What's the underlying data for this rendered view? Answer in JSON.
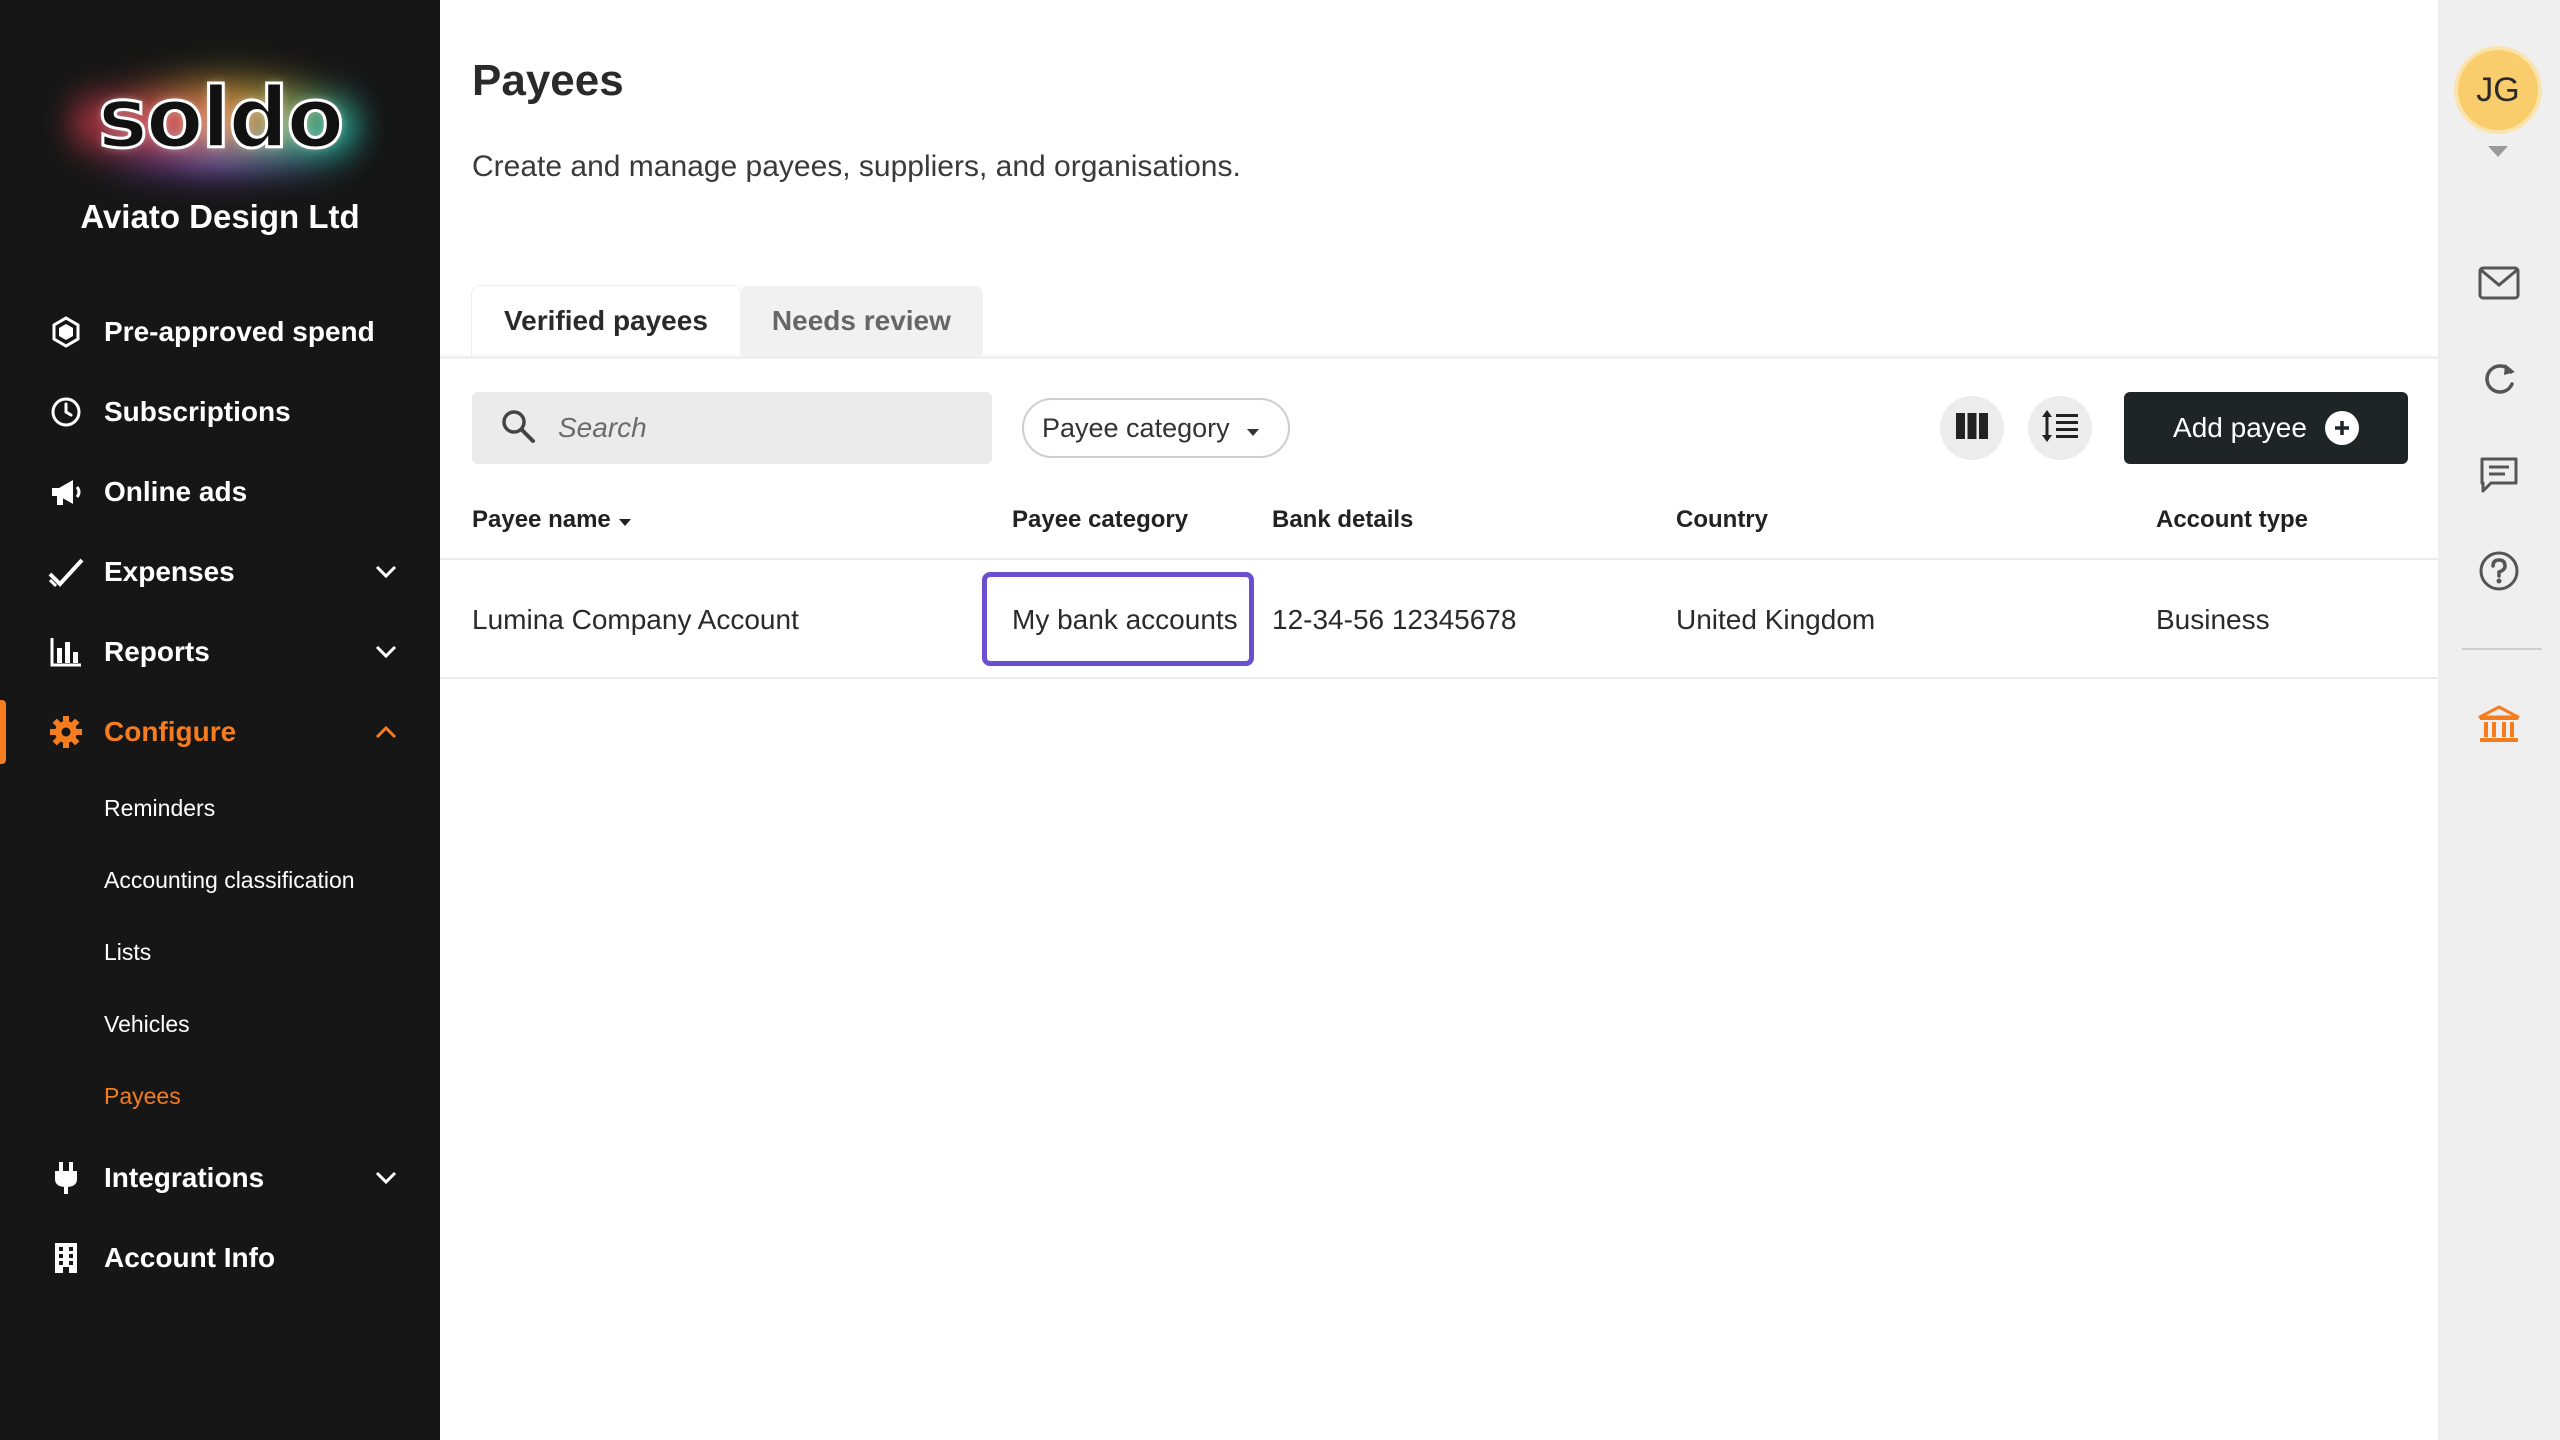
{
  "sidebar": {
    "logo_text": "soldo",
    "company": "Aviato Design Ltd",
    "nav": {
      "preapproved": "Pre-approved spend",
      "subscriptions": "Subscriptions",
      "online_ads": "Online ads",
      "expenses": "Expenses",
      "reports": "Reports",
      "configure": "Configure",
      "integrations": "Integrations",
      "account_info": "Account Info"
    },
    "configure_sub": {
      "reminders": "Reminders",
      "accounting": "Accounting classification",
      "lists": "Lists",
      "vehicles": "Vehicles",
      "payees": "Payees"
    },
    "active_item": "Configure",
    "active_sub_item": "Payees"
  },
  "main": {
    "title": "Payees",
    "subtitle": "Create and manage payees, suppliers, and organisations.",
    "tabs": {
      "verified": "Verified payees",
      "needs_review": "Needs review"
    },
    "search": {
      "placeholder": "Search",
      "value": ""
    },
    "filter_label": "Payee category",
    "add_button": "Add payee",
    "table": {
      "headers": {
        "name": "Payee name",
        "category": "Payee category",
        "bank": "Bank details",
        "country": "Country",
        "type": "Account type"
      },
      "rows": [
        {
          "name": "Lumina Company Account",
          "category": "My bank accounts",
          "bank": "12-34-56 12345678",
          "country": "United Kingdom",
          "type": "Business"
        }
      ]
    }
  },
  "rail": {
    "avatar_initials": "JG",
    "icons": [
      "mail-icon",
      "refresh-icon",
      "chat-icon",
      "help-icon",
      "bank-icon"
    ]
  },
  "colors": {
    "sidebar_bg": "#161616",
    "accent": "#f57c1f",
    "focus": "#6c4fd1",
    "button_dark": "#1f2427",
    "avatar": "#f9cc6c"
  }
}
